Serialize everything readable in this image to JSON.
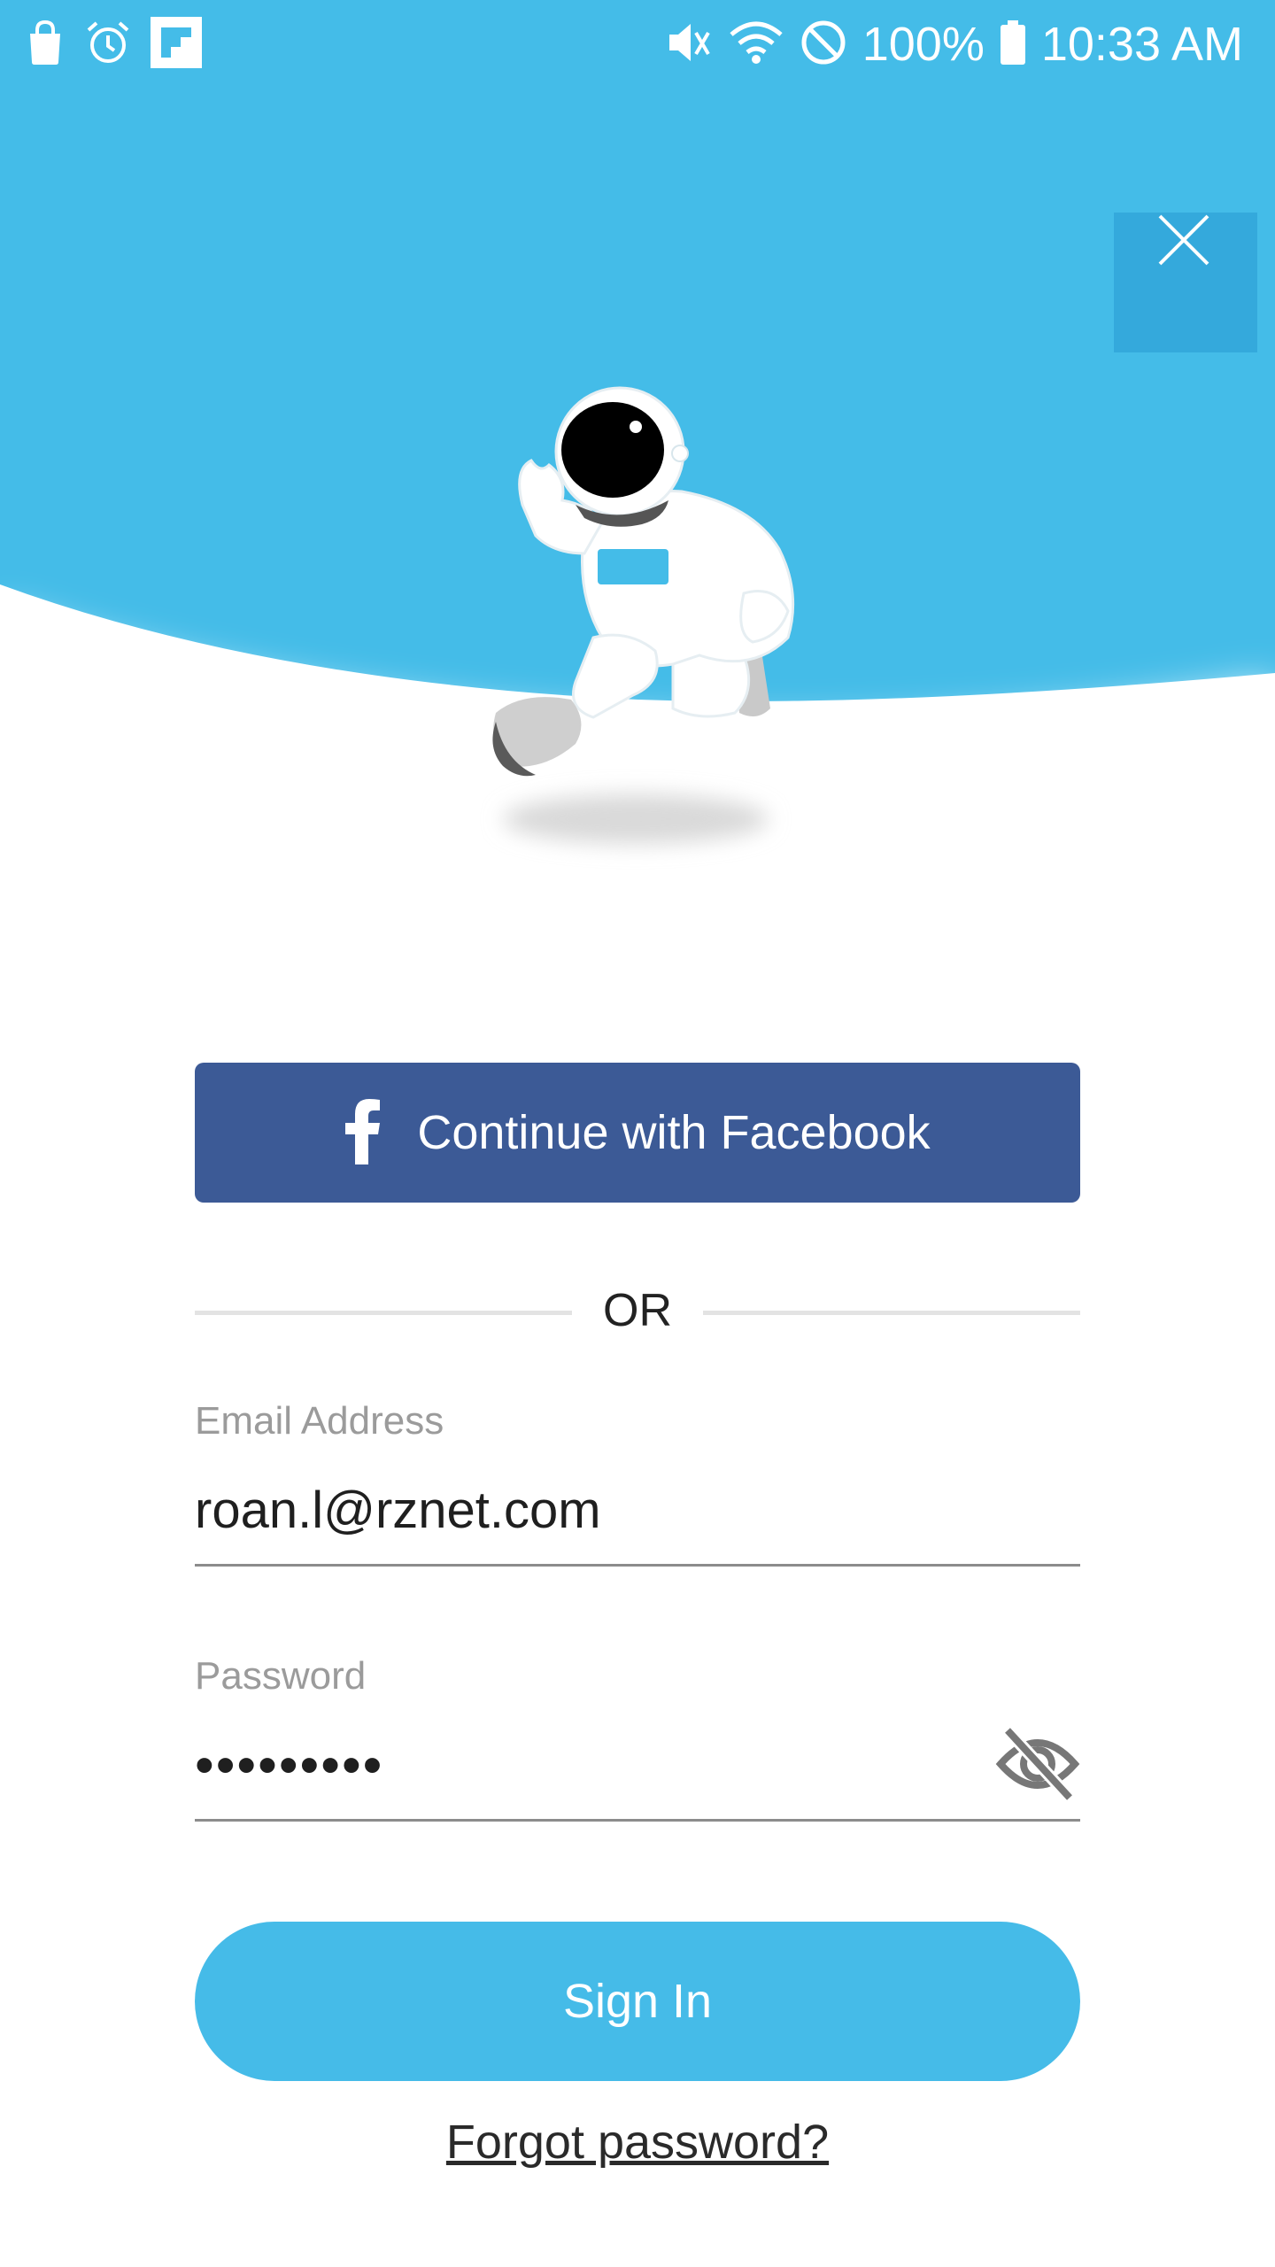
{
  "colors": {
    "sky": "#44bce8",
    "facebook": "#3c5a96",
    "primary": "#45bbe8",
    "close_bg": "#34a9dc"
  },
  "status_bar": {
    "left_icons": [
      "shopping-bag-icon",
      "alarm-icon",
      "flipboard-icon"
    ],
    "right_icons": [
      "vibrate-icon",
      "wifi-icon",
      "do-not-disturb-icon",
      "battery-icon"
    ],
    "battery_percent": "100%",
    "time": "10:33 AM"
  },
  "hero": {
    "illustration": "astronaut-illustration",
    "close_icon": "close-icon"
  },
  "facebook_button": {
    "icon": "facebook-icon",
    "label": "Continue with Facebook"
  },
  "divider": {
    "text": "OR"
  },
  "email": {
    "label": "Email Address",
    "value": "roan.l@rznet.com"
  },
  "password": {
    "label": "Password",
    "value": "•••••••••",
    "toggle_icon": "eye-off-icon"
  },
  "sign_in_button": {
    "label": "Sign In"
  },
  "forgot_password": {
    "label": "Forgot password?"
  }
}
